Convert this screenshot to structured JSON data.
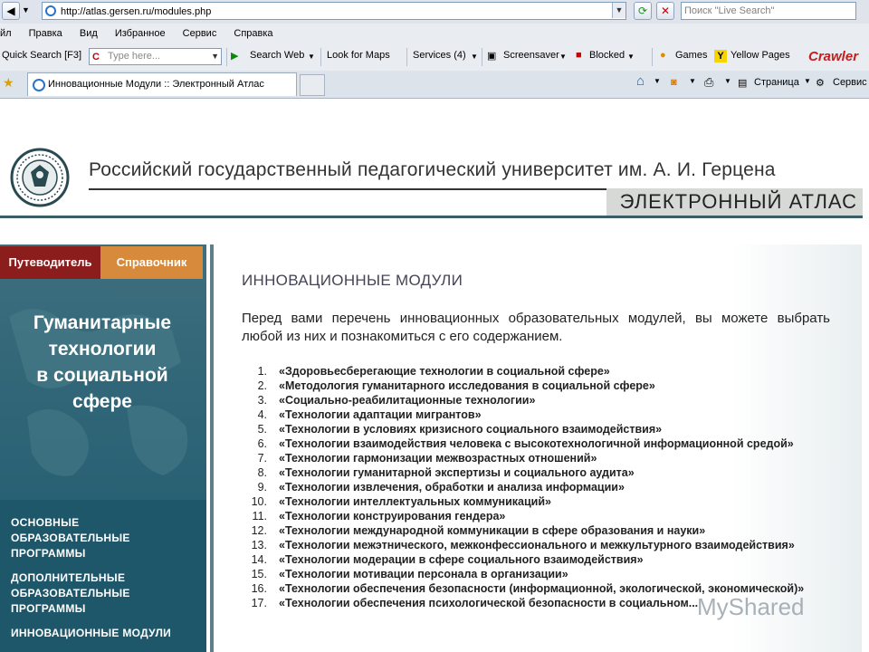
{
  "browser": {
    "url": "http://atlas.gersen.ru/modules.php",
    "search_placeholder": "Поиск \"Live Search\"",
    "menu": [
      "йл",
      "Правка",
      "Вид",
      "Избранное",
      "Сервис",
      "Справка"
    ],
    "toolbar": {
      "quick_search": "Quick Search [F3]",
      "type_here": "Type here...",
      "search_web": "Search Web",
      "look_for_maps": "Look for Maps",
      "services": "Services (4)",
      "screensaver": "Screensaver",
      "blocked": "Blocked",
      "games": "Games",
      "yellow_pages": "Yellow Pages",
      "brand": "Crawler"
    },
    "tab_title": "Инновационные Модули :: Электронный Атлас",
    "commands": {
      "page": "Страница",
      "service": "Сервис"
    }
  },
  "header": {
    "university": "Российский государственный педагогический университет им. А. И. Герцена",
    "atlas": "ЭЛЕКТРОННЫЙ АТЛАС"
  },
  "sidebar": {
    "tab_guide": "Путеводитель",
    "tab_reference": "Справочник",
    "title_lines": [
      "Гуманитарные",
      "технологии",
      "в социальной",
      "сфере"
    ],
    "menu": [
      [
        "ОСНОВНЫЕ",
        "ОБРАЗОВАТЕЛЬНЫЕ",
        "ПРОГРАММЫ"
      ],
      [
        "ДОПОЛНИТЕЛЬНЫЕ",
        "ОБРАЗОВАТЕЛЬНЫЕ",
        "ПРОГРАММЫ"
      ],
      [
        "ИННОВАЦИОННЫЕ МОДУЛИ"
      ]
    ]
  },
  "content": {
    "title": "ИННОВАЦИОННЫЕ МОДУЛИ",
    "intro": "Перед вами перечень инновационных образовательных модулей, вы можете выбрать любой из них и познакомиться с его содержанием.",
    "modules": [
      "«Здоровьесберегающие технологии в социальной сфере»",
      "«Методология гуманитарного исследования в социальной сфере»",
      "«Социально-реабилитационные технологии»",
      "«Технологии адаптации мигрантов»",
      "«Технологии в условиях кризисного социального взаимодействия»",
      "«Технологии взаимодействия человека с высокотехнологичной информационной средой»",
      "«Технологии гармонизации межвозрастных отношений»",
      "«Технологии гуманитарной экспертизы и социального аудита»",
      "«Технологии извлечения, обработки и анализа информации»",
      "«Технологии интеллектуальных коммуникаций»",
      "«Технологии конструирования гендера»",
      "«Технологии международной коммуникации в сфере образования и науки»",
      "«Технологии межэтнического, межконфессионального и межкультурного взаимодействия»",
      "«Технологии модерации в сфере социального взаимодействия»",
      "«Технологии мотивации персонала в организации»",
      "«Технологии обеспечения безопасности (информационной, экологической, экономической)»",
      "«Технологии обеспечения психологической безопасности в социальном..."
    ]
  },
  "watermark": "MyShared",
  "colors": {
    "guide_tab": "#8c1d1d",
    "reference_tab": "#d78a3c",
    "sidebar": "#2f6577"
  }
}
